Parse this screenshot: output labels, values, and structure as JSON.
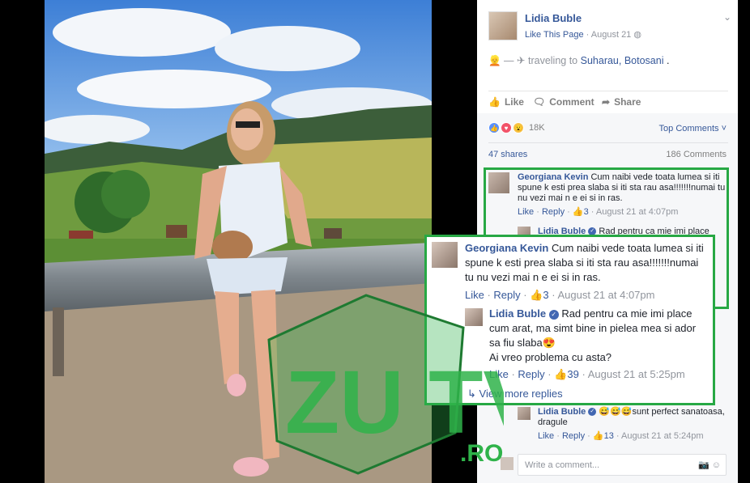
{
  "post": {
    "author": "Lidia Buble",
    "like_page": "Like This Page",
    "date": "August 21",
    "status_prefix": "— ",
    "status_traveling": "traveling to",
    "status_place": "Suharau, Botosani",
    "status_end": ".",
    "actions": {
      "like": "Like",
      "comment": "Comment",
      "share": "Share"
    },
    "reactions_count": "18K",
    "top_comments": "Top Comments",
    "shares": "47 shares",
    "comments_count": "186 Comments",
    "write_placeholder": "Write a comment..."
  },
  "comments": [
    {
      "name": "Georgiana Kevin",
      "text": "Cum naibi vede toata lumea si iti spune k esti prea slaba si iti sta rau asa!!!!!!!numai tu nu vezi mai n e ei si in ras.",
      "like": "Like",
      "reply": "Reply",
      "likes": "3",
      "time": "August 21 at 4:07pm"
    },
    {
      "name": "Lidia Buble",
      "text": "Rad pentru ca mie imi place cum arat, ma simt bine in pielea mea si ador sa fiu slaba",
      "text2": "Ai vreo problema cu asta?",
      "like": "Like",
      "reply": "Reply",
      "likes": "39",
      "time": "August 21 at 5:25pm"
    },
    {
      "name": "Lidia Buble",
      "text": "😅😅😅sunt perfect sanatoasa, dragule",
      "like": "Like",
      "reply": "Reply",
      "likes": "13",
      "time": "August 21 at 5:24pm"
    }
  ],
  "panel_reply_preview": "Rad pentru ca mie imi place",
  "view_more": "View more replies",
  "watermark": {
    "letters": "ZU TV",
    "suffix": ".RO"
  },
  "colors": {
    "link": "#365899",
    "muted": "#90949c",
    "highlight": "#27a844",
    "watermark": "#2fb34a"
  }
}
